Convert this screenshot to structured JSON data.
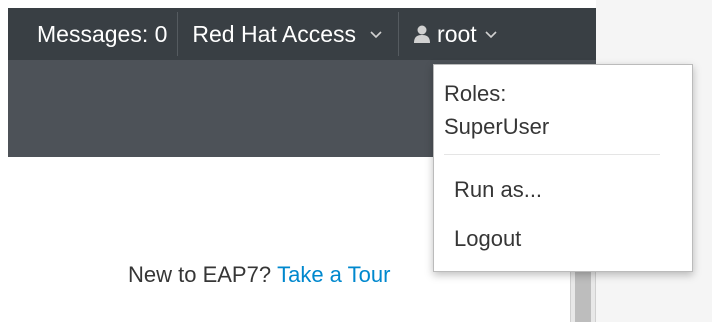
{
  "navbar": {
    "messages_label": "Messages: 0",
    "access_label": "Red Hat Access",
    "user_label": "root"
  },
  "dropdown": {
    "roles_label": "Roles:",
    "roles_value": "SuperUser",
    "items": [
      {
        "label": "Run as..."
      },
      {
        "label": "Logout"
      }
    ]
  },
  "tour": {
    "text": "New to EAP7?",
    "link": "Take a Tour"
  },
  "colors": {
    "navbar_bg": "#393f44",
    "subbar_bg": "#4d5258",
    "link": "#0088ce"
  },
  "icons": {
    "user": "user-icon",
    "chevron": "chevron-down-icon"
  }
}
